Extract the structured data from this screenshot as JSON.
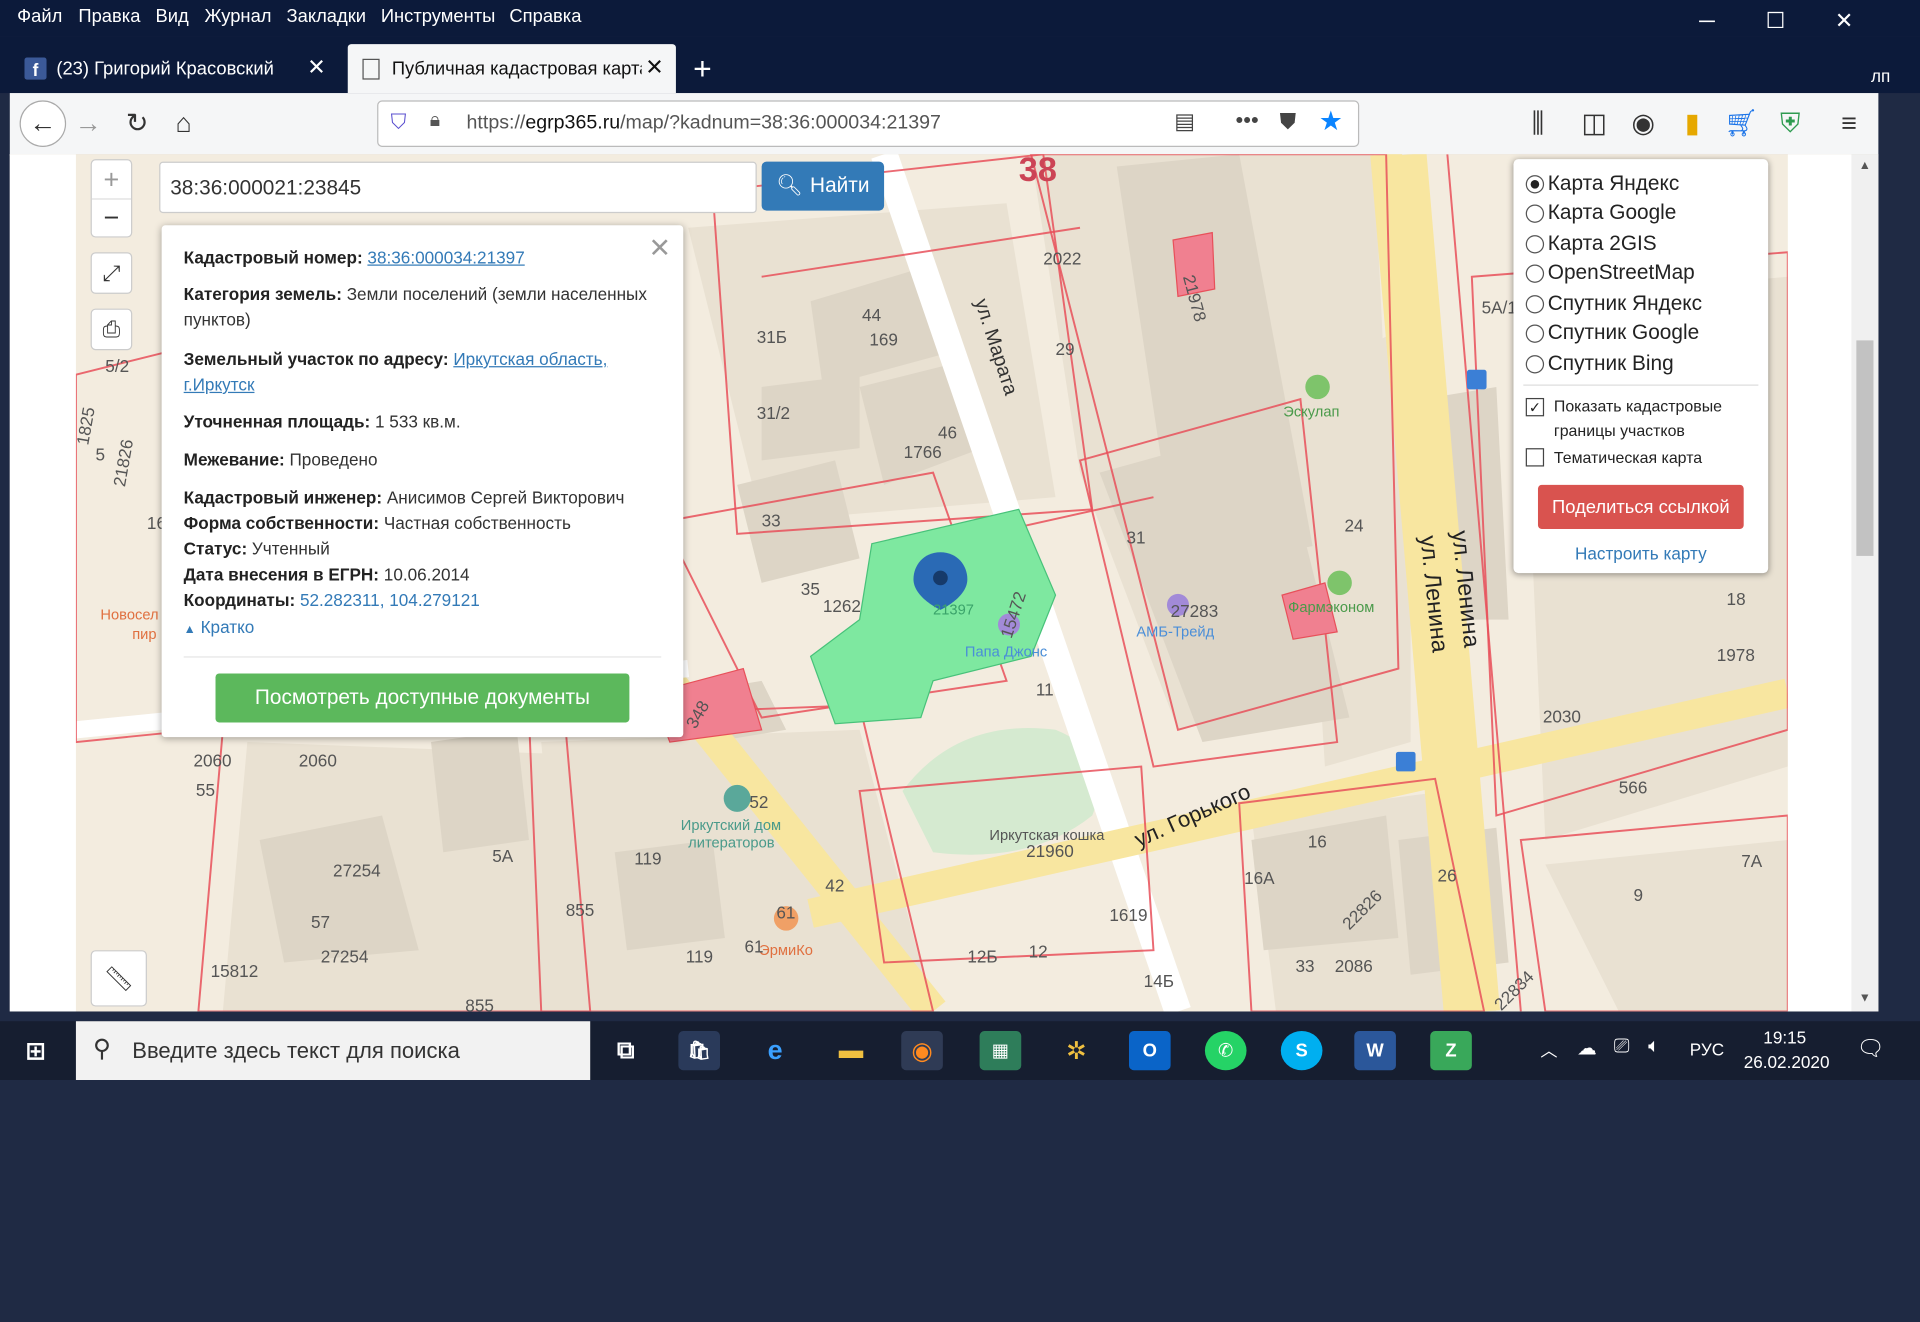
{
  "browser": {
    "menu": [
      "Файл",
      "Правка",
      "Вид",
      "Журнал",
      "Закладки",
      "Инструменты",
      "Справка"
    ],
    "tabs": [
      {
        "title": "(23) Григорий Красовский",
        "icon": "facebook-icon"
      },
      {
        "title": "Публичная кадастровая карта",
        "icon": "page-icon"
      }
    ],
    "new_tab": "+",
    "url_prefix": "https://",
    "url_host": "egrp365.ru",
    "url_path": "/map/?kadnum=38:36:000034:21397",
    "side_partial": "лп"
  },
  "map": {
    "search_value": "38:36:000021:23845",
    "find_label": "Найти",
    "zoom_in": "+",
    "zoom_out": "−",
    "labels": {
      "top_number": "38",
      "street_marata": "ул. Марата",
      "street_lenina_1": "ул. Ленина",
      "street_lenina_2": "ул. Ленина",
      "street_gorkogo": "ул. Горького",
      "parcel_number": "21397",
      "poi_papa": "Папа Джонс",
      "poi_amb": "АМБ-Трейд",
      "poi_eskulap": "Эскулап",
      "poi_farm": "Фармэконом",
      "poi_dom_1": "Иркутский дом",
      "poi_dom_2": "литераторов",
      "poi_koshka": "Иркутская кошка",
      "poi_ermiko": "ЭрмиКо",
      "poi_novo_1": "Новосел",
      "poi_novo_2": "пир",
      "n2022": "2022",
      "n29": "29",
      "n44": "44",
      "n169": "169",
      "n31b": "31Б",
      "n312": "31/2",
      "n46": "46",
      "n1766": "1766",
      "n33": "33",
      "n35": "35",
      "n1262": "1262",
      "n15472": "15472",
      "n11": "11",
      "n31": "31",
      "n24": "24",
      "n27283": "27283",
      "n2060a": "2060",
      "n55": "55",
      "n2060b": "2060",
      "n5a": "5А",
      "n27254a": "27254",
      "n57": "57",
      "n27254b": "27254",
      "n15812": "15812",
      "n119a": "119",
      "n855a": "855",
      "n42": "42",
      "n61a": "61",
      "n61b": "61",
      "n119b": "119",
      "n855b": "855",
      "n52": "52",
      "n21960": "21960",
      "n16": "16",
      "n16a": "16А",
      "n26": "26",
      "n1619": "1619",
      "n12b": "12Б",
      "n12": "12",
      "n14b": "14Б",
      "n33b": "33",
      "n2086": "2086",
      "n22826": "22826",
      "n22834": "22834",
      "n9": "9",
      "n7a": "7А",
      "n566": "566",
      "n2030": "2030",
      "n1978": "1978",
      "n18": "18",
      "n21978": "21978",
      "n5a1": "5А/1",
      "n52b": "5/2",
      "n5": "5",
      "n21826": "21826",
      "n16b": "16",
      "n348": "348",
      "n1825": "1825"
    }
  },
  "popup": {
    "kad_label": "Кадастровый номер:",
    "kad_value": "38:36:000034:21397",
    "cat_label": "Категория земель:",
    "cat_value": "Земли поселений (земли населенных пунктов)",
    "addr_label": "Земельный участок по адресу:",
    "addr_value": "Иркутская область, г.Иркутск",
    "area_label": "Уточненная площадь:",
    "area_value": "1 533 кв.м.",
    "mezh_label": "Межевание:",
    "mezh_value": "Проведено",
    "eng_label": "Кадастровый инженер:",
    "eng_value": "Анисимов Сергей Викторович",
    "own_label": "Форма собственности:",
    "own_value": "Частная собственность",
    "status_label": "Статус:",
    "status_value": "Учтенный",
    "date_label": "Дата внесения в ЕГРН:",
    "date_value": "10.06.2014",
    "coord_label": "Координаты:",
    "coord_value": "52.282311, 104.279121",
    "brief": "Кратко",
    "docs_button": "Посмотреть доступные документы"
  },
  "layers": {
    "options": [
      {
        "label": "Карта Яндекс",
        "selected": true
      },
      {
        "label": "Карта Google",
        "selected": false
      },
      {
        "label": "Карта 2GIS",
        "selected": false
      },
      {
        "label": "OpenStreetMap",
        "selected": false
      },
      {
        "label": "Спутник Яндекс",
        "selected": false
      },
      {
        "label": "Спутник Google",
        "selected": false
      },
      {
        "label": "Спутник Bing",
        "selected": false
      }
    ],
    "check_cadastral_1": "Показать кадастровые",
    "check_cadastral_2": "границы участков",
    "check_thematic": "Тематическая карта",
    "share": "Поделиться ссылкой",
    "configure": "Настроить карту"
  },
  "taskbar": {
    "search_placeholder": "Введите здесь текст для поиска",
    "lang": "РУС",
    "time": "19:15",
    "date": "26.02.2020"
  },
  "colors": {
    "parcel_green": "#7ee8a0",
    "cadastral_border": "#e8505a",
    "find_button": "#337ab7",
    "docs_button": "#5cb85c",
    "share_button": "#d9534f"
  }
}
